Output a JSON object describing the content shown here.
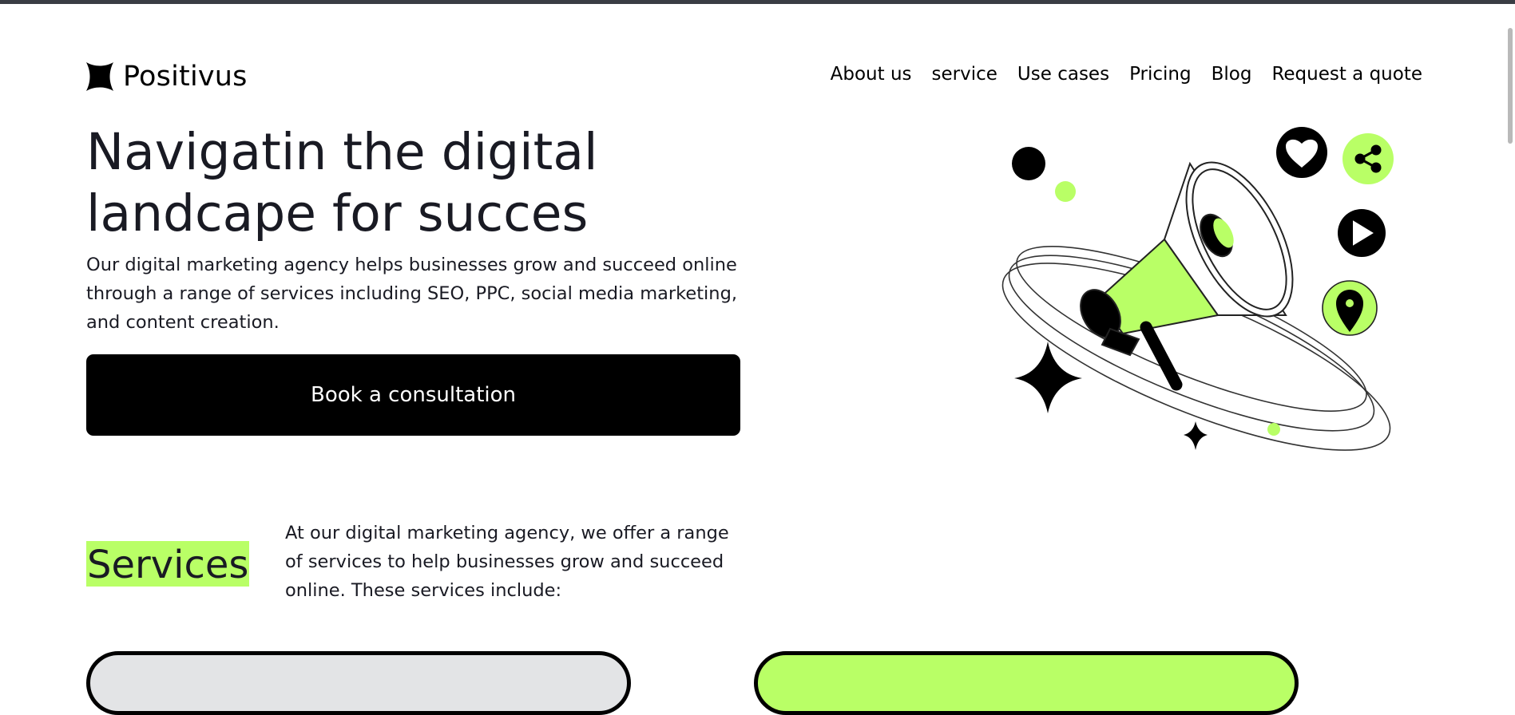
{
  "brand": {
    "name": "Positivus",
    "logo_icon": "star-logo-icon"
  },
  "nav": {
    "items": [
      {
        "label": "About us"
      },
      {
        "label": "service"
      },
      {
        "label": "Use cases"
      },
      {
        "label": "Pricing"
      },
      {
        "label": "Blog"
      },
      {
        "label": "Request a quote"
      }
    ]
  },
  "hero": {
    "title_line1": "Navigatin the digital",
    "title_line2": "landcape for succes",
    "description": "Our digital marketing agency helps businesses grow and succeed online through a range of services including SEO, PPC, social media marketing, and content creation.",
    "cta_label": "Book a consultation",
    "illustration": "megaphone-illustration"
  },
  "services": {
    "title": "Services",
    "description": "At our digital marketing agency, we offer a range of services to help businesses grow and succeed online. These services include:"
  },
  "colors": {
    "accent": "#b9ff66",
    "dark": "#191a23",
    "card_grey": "#e3e4e6",
    "black": "#000000"
  }
}
